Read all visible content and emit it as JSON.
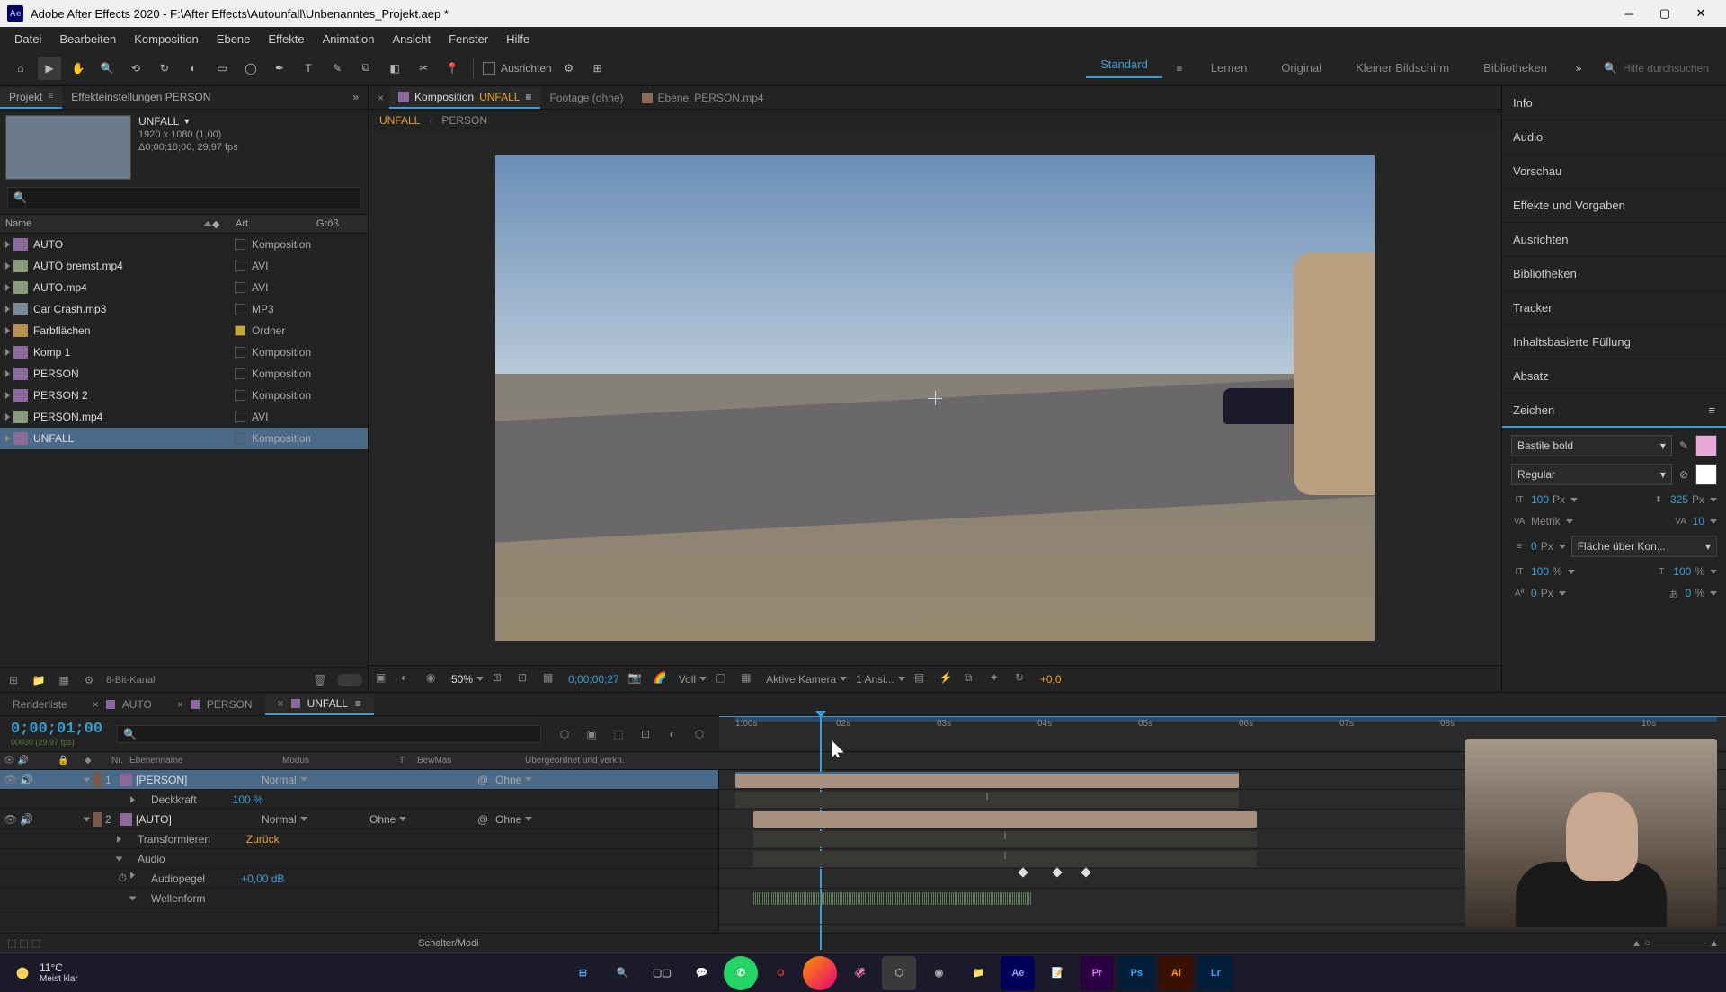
{
  "titlebar": {
    "app": "Ae",
    "title": "Adobe After Effects 2020 - F:\\After Effects\\Autounfall\\Unbenanntes_Projekt.aep *"
  },
  "menu": [
    "Datei",
    "Bearbeiten",
    "Komposition",
    "Ebene",
    "Effekte",
    "Animation",
    "Ansicht",
    "Fenster",
    "Hilfe"
  ],
  "toolbar": {
    "ausrichten": "Ausrichten",
    "workspaces": [
      "Standard",
      "Lernen",
      "Original",
      "Kleiner Bildschirm",
      "Bibliotheken"
    ],
    "active_ws": "Standard",
    "search_placeholder": "Hilfe durchsuchen"
  },
  "project": {
    "tabs": {
      "projekt": "Projekt",
      "effekt": "Effekteinstellungen PERSON"
    },
    "comp_name": "UNFALL",
    "comp_dims": "1920 x 1080 (1,00)",
    "comp_duration": "Δ0;00;10;00, 29,97 fps",
    "cols": {
      "name": "Name",
      "label": "",
      "art": "Art",
      "groesse": "Größ"
    },
    "items": [
      {
        "name": "AUTO",
        "art": "Komposition",
        "icon": "comp"
      },
      {
        "name": "AUTO bremst.mp4",
        "art": "AVI",
        "icon": "avi"
      },
      {
        "name": "AUTO.mp4",
        "art": "AVI",
        "icon": "avi"
      },
      {
        "name": "Car Crash.mp3",
        "art": "MP3",
        "icon": "mp3"
      },
      {
        "name": "Farbflächen",
        "art": "Ordner",
        "icon": "folder",
        "yellow": true
      },
      {
        "name": "Komp 1",
        "art": "Komposition",
        "icon": "comp"
      },
      {
        "name": "PERSON",
        "art": "Komposition",
        "icon": "comp"
      },
      {
        "name": "PERSON 2",
        "art": "Komposition",
        "icon": "comp"
      },
      {
        "name": "PERSON.mp4",
        "art": "AVI",
        "icon": "avi"
      },
      {
        "name": "UNFALL",
        "art": "Komposition",
        "icon": "comp",
        "selected": true
      }
    ],
    "depth": "8-Bit-Kanal"
  },
  "comp": {
    "tabs": {
      "comp_prefix": "Komposition",
      "comp_name": "UNFALL",
      "footage": "Footage (ohne)",
      "ebene_prefix": "Ebene",
      "ebene_name": "PERSON.mp4"
    },
    "breadcrumb": [
      "UNFALL",
      "PERSON"
    ],
    "footer": {
      "zoom": "50%",
      "tc": "0;00;00;27",
      "res": "Voll",
      "camera": "Aktive Kamera",
      "views": "1 Ansi...",
      "exp": "+0,0"
    }
  },
  "right": {
    "sections": [
      "Info",
      "Audio",
      "Vorschau",
      "Effekte und Vorgaben",
      "Ausrichten",
      "Bibliotheken",
      "Tracker",
      "Inhaltsbasierte Füllung",
      "Absatz",
      "Zeichen"
    ],
    "char": {
      "font": "Bastile bold",
      "style": "Regular",
      "size": "100",
      "size_unit": "Px",
      "leading": "325",
      "leading_unit": "Px",
      "kerning": "Metrik",
      "tracking": "10",
      "stroke": "0",
      "stroke_unit": "Px",
      "stroke_mode": "Fläche über Kon...",
      "vscale": "100",
      "vscale_unit": "%",
      "hscale": "100",
      "hscale_unit": "%",
      "baseline": "0",
      "baseline_unit": "Px",
      "tsume": "0",
      "tsume_unit": "%"
    }
  },
  "timeline": {
    "tabs": [
      "Renderliste",
      "AUTO",
      "PERSON",
      "UNFALL"
    ],
    "active_tab": "UNFALL",
    "timecode": "0;00;01;00",
    "frames_sub": "00030 (29.97 fps)",
    "cols": {
      "nr": "Nr.",
      "name": "Ebenenname",
      "modus": "Modus",
      "t": "T",
      "bewmas": "BewMas",
      "parent": "Übergeordnet und verkn."
    },
    "ruler_ticks": [
      "1:00s",
      "02s",
      "03s",
      "04s",
      "05s",
      "06s",
      "07s",
      "08s",
      "10s"
    ],
    "layers": [
      {
        "num": "1",
        "name": "[PERSON]",
        "mode": "Normal",
        "parent": "Ohne",
        "selected": true,
        "props": [
          {
            "name": "Deckkraft",
            "val": "100 %"
          }
        ]
      },
      {
        "num": "2",
        "name": "[AUTO]",
        "mode": "Normal",
        "bewmas": "Ohne",
        "parent": "Ohne",
        "props": [
          {
            "name": "Transformieren",
            "link": "Zurück"
          },
          {
            "name": "Audio"
          },
          {
            "name": "Audiopegel",
            "val": "+0,00 dB"
          },
          {
            "name": "Wellenform"
          }
        ]
      }
    ],
    "footer": {
      "switch": "Schalter/Modi"
    }
  },
  "taskbar": {
    "temp": "11°C",
    "weather": "Meist klar"
  }
}
